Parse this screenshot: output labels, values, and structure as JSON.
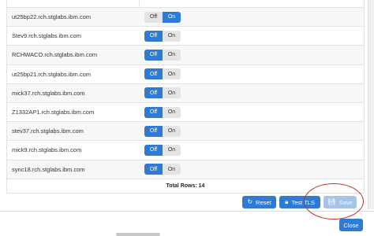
{
  "hosts": [
    {
      "name": "ut25bp22.rch.stglabs.ibm.com",
      "state": "On"
    },
    {
      "name": "Stev9.rch.stglabs.ibm.com",
      "state": "Off"
    },
    {
      "name": "RCHWACO.rch.stglabs.ibm.com",
      "state": "Off"
    },
    {
      "name": "ut25bp21.rch.stglabs.ibm.com",
      "state": "Off"
    },
    {
      "name": "mick37.rch.stglabs.ibm.com",
      "state": "Off"
    },
    {
      "name": "Z1332AP1.rch.stglabs.ibm.com",
      "state": "Off"
    },
    {
      "name": "stev37.rch.stglabs.ibm.com",
      "state": "Off"
    },
    {
      "name": "mick9.rch.stglabs.ibm.com",
      "state": "Off"
    },
    {
      "name": "sync18.rch.stglabs.ibm.com",
      "state": "Off"
    }
  ],
  "toggle": {
    "off_label": "Off",
    "on_label": "On"
  },
  "table": {
    "total_rows": "Total Rows: 14"
  },
  "actions": {
    "reset_label": "Reset",
    "test_tls_label": "Test TLS",
    "save_label": "Save",
    "close_label": "Close"
  },
  "colors": {
    "primary": "#2e7bd4",
    "highlight_circle": "#c0302b"
  }
}
